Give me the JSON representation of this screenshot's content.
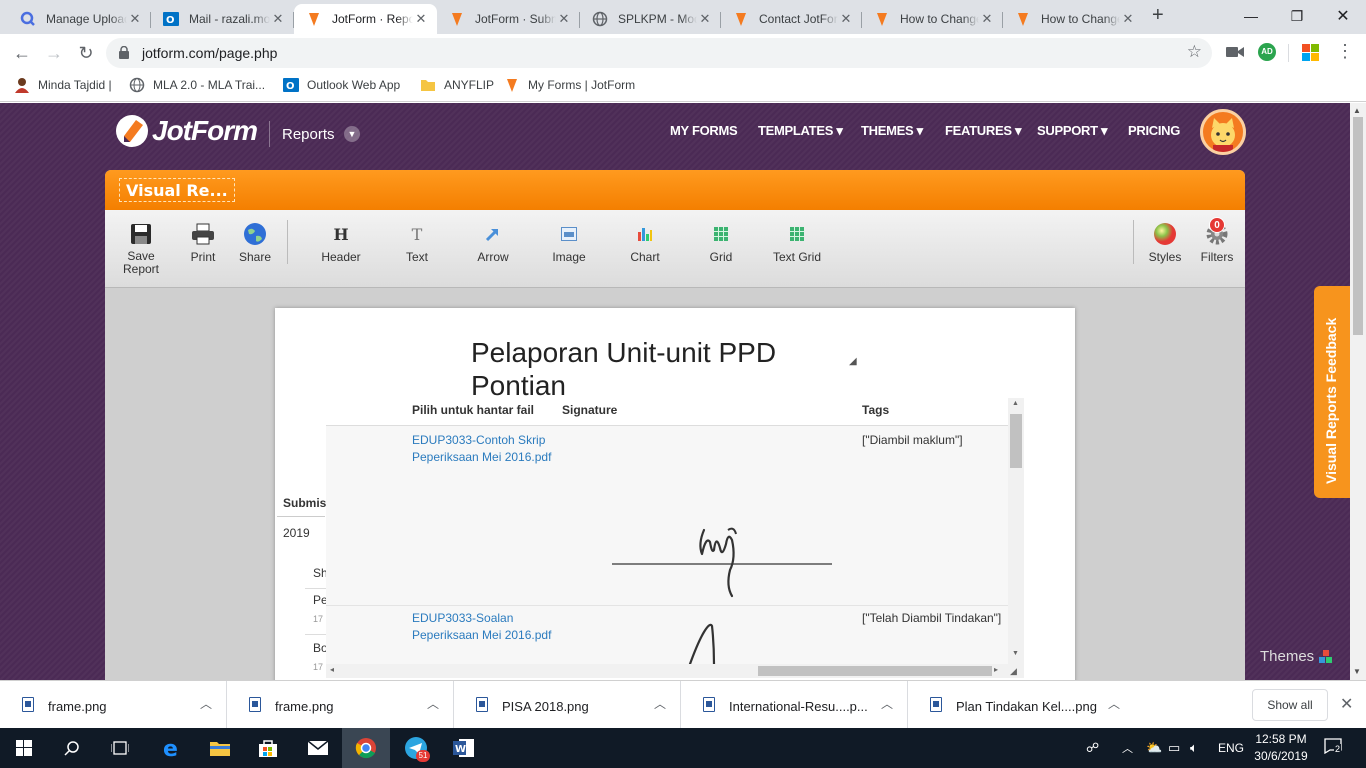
{
  "browser": {
    "tabs": [
      {
        "title": "Manage Uploads",
        "icon": "search-favicon",
        "active": false
      },
      {
        "title": "Mail - razali.mohd",
        "icon": "outlook-favicon",
        "active": false
      },
      {
        "title": "JotForm · Reports",
        "icon": "jotform-favicon",
        "active": true
      },
      {
        "title": "JotForm · Submissions",
        "icon": "jotform-favicon",
        "active": false
      },
      {
        "title": "SPLKPM - Modul",
        "icon": "globe-favicon",
        "active": false
      },
      {
        "title": "Contact JotForm",
        "icon": "jotform-favicon",
        "active": false
      },
      {
        "title": "How to Change",
        "icon": "jotform-favicon",
        "active": false
      },
      {
        "title": "How to Change",
        "icon": "jotform-favicon",
        "active": false
      }
    ],
    "new_tab": "+",
    "url": "jotform.com/page.php",
    "profile_initials": "AD",
    "bookmarks": [
      {
        "label": "Minda Tajdid |",
        "icon": "person-icon"
      },
      {
        "label": "MLA 2.0 - MLA Trai...",
        "icon": "globe-icon"
      },
      {
        "label": "Outlook Web App",
        "icon": "outlook-icon"
      },
      {
        "label": "ANYFLIP",
        "icon": "folder-icon"
      },
      {
        "label": "My Forms | JotForm",
        "icon": "jotform-icon"
      }
    ]
  },
  "jotform": {
    "logo": "JotForm",
    "section": "Reports",
    "nav": [
      "MY FORMS",
      "TEMPLATES ▾",
      "THEMES ▾",
      "FEATURES ▾",
      "SUPPORT ▾",
      "PRICING"
    ],
    "report_title": "Visual Re...",
    "toolbar": {
      "save": "Save Report",
      "print": "Print",
      "share": "Share",
      "header": "Header",
      "text": "Text",
      "arrow": "Arrow",
      "image": "Image",
      "chart": "Chart",
      "grid": "Grid",
      "text_grid": "Text Grid",
      "styles": "Styles",
      "filters": "Filters",
      "filters_count": "0"
    },
    "report": {
      "title": "Pelaporan Unit-unit PPD Pontian",
      "submission_label": "Submis",
      "date_stub": "2019",
      "stubs": [
        "Sh",
        "Pe",
        "17",
        "Bo",
        "17"
      ],
      "grid_columns": [
        "Pilih untuk hantar fail",
        "Signature",
        "Tags"
      ],
      "grid_rows": [
        {
          "file": "EDUP3033-Contoh Skrip Peperiksaan Mei 2016.pdf",
          "tags": "[\"Diambil maklum\"]"
        },
        {
          "file": "EDUP3033-Soalan Peperiksaan Mei 2016.pdf",
          "tags": "[\"Telah Diambil Tindakan\"]"
        }
      ]
    },
    "feedback_tab": "Visual Reports Feedback",
    "themes": "Themes"
  },
  "downloads": {
    "items": [
      "frame.png",
      "frame.png",
      "PISA 2018.png",
      "International-Resu....p...",
      "Plan Tindakan Kel....png"
    ],
    "show_all": "Show all"
  },
  "taskbar": {
    "language": "ENG",
    "time": "12:58 PM",
    "date": "30/6/2019",
    "telegram_badge": "51",
    "notifications": "2"
  }
}
